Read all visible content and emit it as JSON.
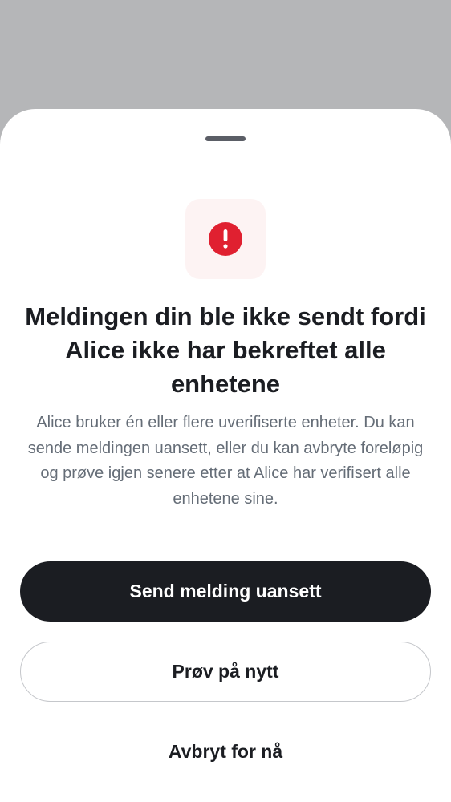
{
  "dialog": {
    "title": "Meldingen din ble ikke sendt fordi Alice ikke har bekreftet alle enhetene",
    "description": "Alice bruker én eller flere uverifiserte enheter. Du kan sende meldingen uansett, eller du kan avbryte foreløpig og prøve igjen senere etter at Alice har verifisert alle enhetene sine.",
    "icon": "error-alert-icon"
  },
  "actions": {
    "send_anyway": "Send melding uansett",
    "retry": "Prøv på nytt",
    "cancel": "Avbryt for nå"
  },
  "colors": {
    "scrim": "#b5b6b8",
    "sheet": "#ffffff",
    "alert_red": "#e02030",
    "alert_tile_bg": "#fdf3f3",
    "primary_button": "#1b1d22",
    "body_text": "#656d77"
  }
}
